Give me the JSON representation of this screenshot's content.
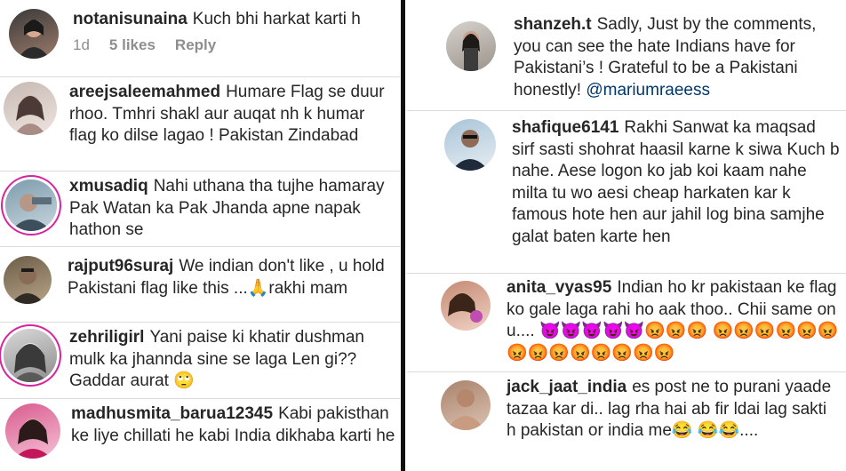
{
  "left": {
    "comments": [
      {
        "username": "notanisunaina",
        "text": "Kuch bhi harkat karti h",
        "time": "1d",
        "likes": "5 likes",
        "reply": "Reply"
      },
      {
        "username": "areejsaleemahmed",
        "text": "Humare Flag se duur rhoo. Tmhri shakl aur auqat nh k humar flag ko dilse lagao ! Pakistan Zindabad"
      },
      {
        "username": "xmusadiq",
        "text": "Nahi uthana tha tujhe hamaray Pak Watan ka Pak Jhanda apne napak hathon se"
      },
      {
        "username": "rajput96suraj",
        "text": "We indian don't like , u hold Pakistani flag  like this ...🙏rakhi mam"
      },
      {
        "username": "zehriligirl",
        "text": "Yani paise ki khatir dushman mulk ka jhannda sine se laga Len gi?? Gaddar aurat 🙄"
      },
      {
        "username": "madhusmita_barua12345",
        "text": "Kabi pakisthan ke liye chillati he kabi India dikhaba karti he"
      }
    ]
  },
  "right": {
    "comments": [
      {
        "username": "shanzeh.t",
        "text": "Sadly, Just by the comments, you can see the hate Indians have for Pakistani’s ! Grateful to be a Pakistani honestly!",
        "mention": "@mariumraeess"
      },
      {
        "username": "shafique6141",
        "text": "Rakhi Sanwat ka maqsad sirf sasti shohrat haasil karne k siwa Kuch b nahe.  Aese logon ko jab koi kaam nahe milta tu wo aesi cheap harkaten kar k famous hote hen aur jahil log bina samjhe galat baten karte hen"
      },
      {
        "username": "anita_vyas95",
        "text": "Indian ho kr pakistaan ke flag ko gale laga rahi ho aak thoo.. Chii same on u....",
        "emojis1": "😈😈😈😈😈😡😡😡",
        "emojis2": "😡😡😡😡😡😡😡😡😡😡😡😡😡😡"
      },
      {
        "username": "jack_jaat_india",
        "text": "es  post ne to purani yaade tazaa kar di.. lag rha hai ab fir ldai lag sakti h  pakistan or  india me😂",
        "emojis2": "😂😂...."
      }
    ]
  }
}
